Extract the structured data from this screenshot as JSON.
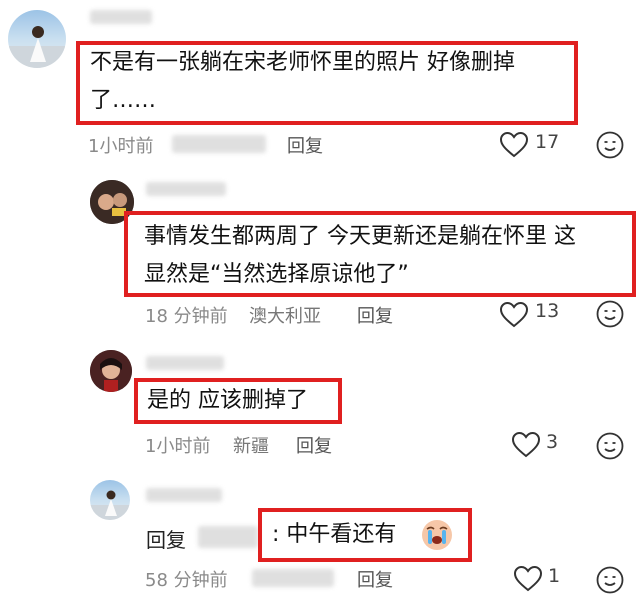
{
  "comments": [
    {
      "text_line1": "不是有一张躺在宋老师怀里的照片 好像删掉",
      "text_line2": "了……",
      "time": "1小时前",
      "reply_label": "回复",
      "likes": "17"
    },
    {
      "text_line1": "事情发生都两周了 今天更新还是躺在怀里 这",
      "text_line2": "显然是“当然选择原谅他了”",
      "time": "18 分钟前",
      "location": "澳大利亚",
      "reply_label": "回复",
      "likes": "13"
    },
    {
      "text_line1": "是的 应该删掉了",
      "time": "1小时前",
      "location": "新疆",
      "reply_label": "回复",
      "likes": "3"
    },
    {
      "reply_prefix": "回复",
      "text_line1": ": 中午看还有",
      "time": "58 分钟前",
      "reply_label": "回复",
      "likes": "1"
    }
  ],
  "colors": {
    "highlight": "#e02020",
    "meta": "#8a8a8a"
  },
  "icons": [
    "heart-icon",
    "emoji-icon",
    "crying-face-icon"
  ]
}
